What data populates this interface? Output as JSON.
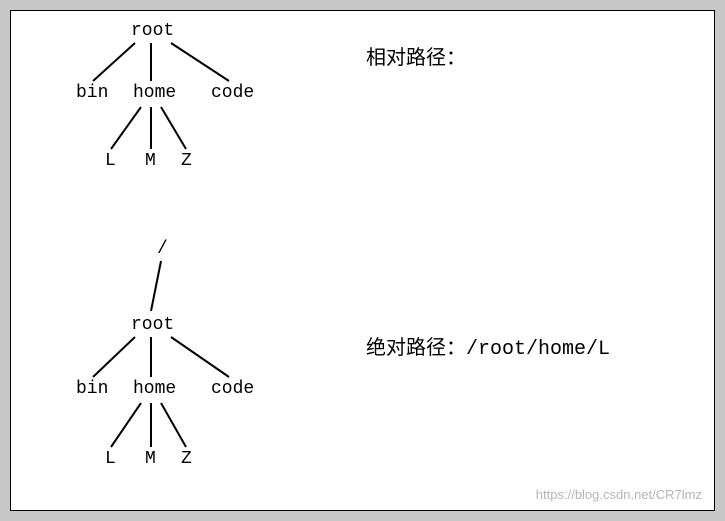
{
  "tree1": {
    "root": "root",
    "bin": "bin",
    "home": "home",
    "code": "code",
    "L": "L",
    "M": "M",
    "Z": "Z"
  },
  "tree2": {
    "slash": "/",
    "root": "root",
    "bin": "bin",
    "home": "home",
    "code": "code",
    "L": "L",
    "M": "M",
    "Z": "Z"
  },
  "labels": {
    "relative": "相对路径：",
    "absolute": "绝对路径：/root/home/L"
  },
  "watermark": "https://blog.csdn.net/CR7lmz",
  "chart_data": [
    {
      "type": "tree",
      "title": "相对路径",
      "nodes": [
        "root",
        "bin",
        "home",
        "code",
        "L",
        "M",
        "Z"
      ],
      "edges": [
        [
          "root",
          "bin"
        ],
        [
          "root",
          "home"
        ],
        [
          "root",
          "code"
        ],
        [
          "home",
          "L"
        ],
        [
          "home",
          "M"
        ],
        [
          "home",
          "Z"
        ]
      ]
    },
    {
      "type": "tree",
      "title": "绝对路径",
      "path_example": "/root/home/L",
      "nodes": [
        "/",
        "root",
        "bin",
        "home",
        "code",
        "L",
        "M",
        "Z"
      ],
      "edges": [
        [
          "/",
          "root"
        ],
        [
          "root",
          "bin"
        ],
        [
          "root",
          "home"
        ],
        [
          "root",
          "code"
        ],
        [
          "home",
          "L"
        ],
        [
          "home",
          "M"
        ],
        [
          "home",
          "Z"
        ]
      ]
    }
  ]
}
